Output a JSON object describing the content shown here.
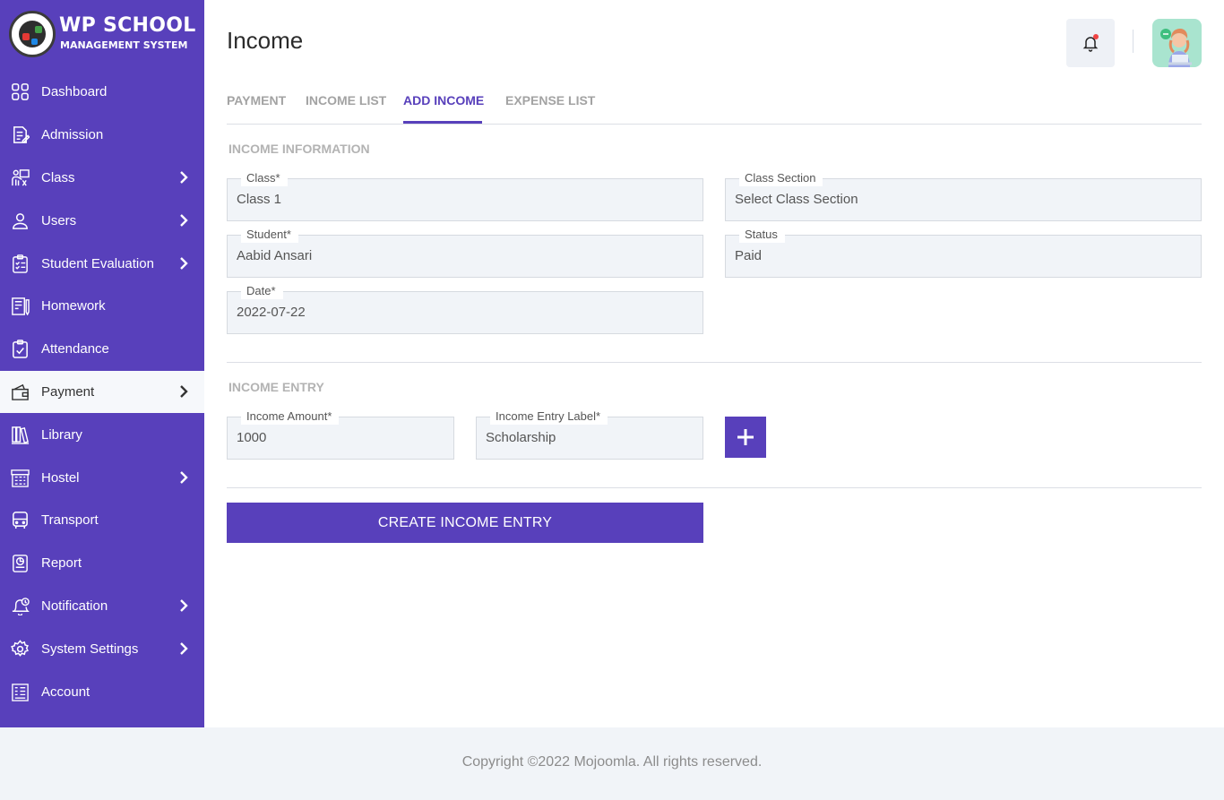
{
  "brand": {
    "title": "WP SCHOOL",
    "subtitle": "MANAGEMENT SYSTEM"
  },
  "sidebar": {
    "items": [
      {
        "label": "Dashboard",
        "icon": "dashboard-icon",
        "has_children": false,
        "active": false
      },
      {
        "label": "Admission",
        "icon": "admission-icon",
        "has_children": false,
        "active": false
      },
      {
        "label": "Class",
        "icon": "class-icon",
        "has_children": true,
        "active": false
      },
      {
        "label": "Users",
        "icon": "user-icon",
        "has_children": true,
        "active": false
      },
      {
        "label": "Student Evaluation",
        "icon": "evaluation-icon",
        "has_children": true,
        "active": false
      },
      {
        "label": "Homework",
        "icon": "homework-icon",
        "has_children": false,
        "active": false
      },
      {
        "label": "Attendance",
        "icon": "attendance-icon",
        "has_children": false,
        "active": false
      },
      {
        "label": "Payment",
        "icon": "wallet-icon",
        "has_children": true,
        "active": true
      },
      {
        "label": "Library",
        "icon": "library-icon",
        "has_children": false,
        "active": false
      },
      {
        "label": "Hostel",
        "icon": "hostel-icon",
        "has_children": true,
        "active": false
      },
      {
        "label": "Transport",
        "icon": "bus-icon",
        "has_children": false,
        "active": false
      },
      {
        "label": "Report",
        "icon": "report-icon",
        "has_children": false,
        "active": false
      },
      {
        "label": "Notification",
        "icon": "notification-icon",
        "has_children": true,
        "active": false
      },
      {
        "label": "System Settings",
        "icon": "gear-icon",
        "has_children": true,
        "active": false
      },
      {
        "label": "Account",
        "icon": "account-icon",
        "has_children": false,
        "active": false
      }
    ]
  },
  "header": {
    "title": "Income"
  },
  "tabs": [
    {
      "label": "PAYMENT",
      "active": false
    },
    {
      "label": "INCOME LIST",
      "active": false
    },
    {
      "label": "ADD INCOME",
      "active": true
    },
    {
      "label": "EXPENSE LIST",
      "active": false
    }
  ],
  "income_info": {
    "section_title": "INCOME INFORMATION",
    "class": {
      "label": "Class*",
      "value": "Class 1"
    },
    "class_section": {
      "label": "Class Section",
      "value": "Select Class Section"
    },
    "student": {
      "label": "Student*",
      "value": "Aabid Ansari"
    },
    "status": {
      "label": "Status",
      "value": "Paid"
    },
    "date": {
      "label": "Date*",
      "value": "2022-07-22"
    }
  },
  "income_entry": {
    "section_title": "INCOME ENTRY",
    "amount": {
      "label": "Income Amount*",
      "value": "1000"
    },
    "entry_label": {
      "label": "Income Entry Label*",
      "value": "Scholarship"
    }
  },
  "actions": {
    "create_label": "CREATE INCOME ENTRY"
  },
  "footer": {
    "text": "Copyright ©2022 Mojoomla. All rights reserved."
  },
  "colors": {
    "primary": "#5840bb",
    "active_bg": "#f6f8fb",
    "field_bg": "#f1f4f8",
    "notification_dot": "#f04444"
  }
}
